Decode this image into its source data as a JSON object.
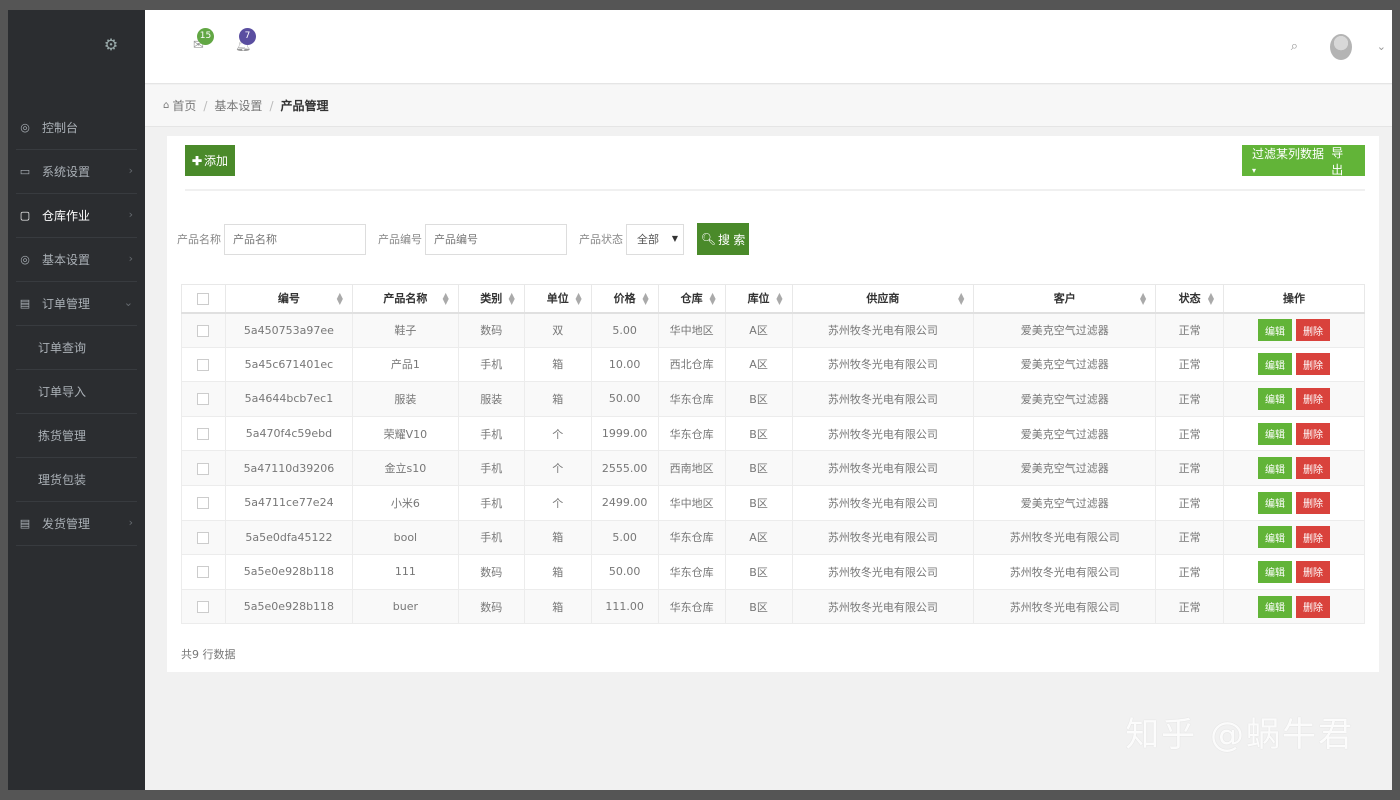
{
  "header": {
    "mail_badge": "15",
    "bell_badge": "7",
    "search_icon": "search-icon",
    "caret": "⌄"
  },
  "sidebar": {
    "items": [
      {
        "label": "控制台",
        "icon": "◎",
        "arrow": ""
      },
      {
        "label": "系统设置",
        "icon": "▭",
        "arrow": "›"
      },
      {
        "label": "仓库作业",
        "icon": "▢",
        "arrow": "›"
      },
      {
        "label": "基本设置",
        "icon": "◎",
        "arrow": "›"
      },
      {
        "label": "订单管理",
        "icon": "▤",
        "arrow": "⌄"
      },
      {
        "label": "订单查询",
        "icon": "",
        "arrow": ""
      },
      {
        "label": "订单导入",
        "icon": "",
        "arrow": ""
      },
      {
        "label": "拣货管理",
        "icon": "",
        "arrow": ""
      },
      {
        "label": "理货包装",
        "icon": "",
        "arrow": ""
      },
      {
        "label": "发货管理",
        "icon": "▤",
        "arrow": "›"
      }
    ]
  },
  "breadcrumb": {
    "home": "首页",
    "level1": "基本设置",
    "current": "产品管理",
    "sep": "/"
  },
  "toolbar": {
    "add_label": "添加",
    "filter_label": "过滤某列数据",
    "export_label": "导出"
  },
  "search": {
    "name_label": "产品名称",
    "name_placeholder": "产品名称",
    "code_label": "产品编号",
    "code_placeholder": "产品编号",
    "status_label": "产品状态",
    "status_value": "全部",
    "search_button": "搜 索"
  },
  "table": {
    "headers": [
      "编号",
      "产品名称",
      "类别",
      "单位",
      "价格",
      "仓库",
      "库位",
      "供应商",
      "客户",
      "状态",
      "操作"
    ],
    "edit_label": "编辑",
    "delete_label": "删除",
    "rows": [
      {
        "id": "5a450753a97ee",
        "name": "鞋子",
        "cat": "数码",
        "unit": "双",
        "price": "5.00",
        "wh": "华中地区",
        "loc": "A区",
        "supplier": "苏州牧冬光电有限公司",
        "customer": "爱美克空气过滤器",
        "status": "正常"
      },
      {
        "id": "5a45c671401ec",
        "name": "产品1",
        "cat": "手机",
        "unit": "箱",
        "price": "10.00",
        "wh": "西北仓库",
        "loc": "A区",
        "supplier": "苏州牧冬光电有限公司",
        "customer": "爱美克空气过滤器",
        "status": "正常"
      },
      {
        "id": "5a4644bcb7ec1",
        "name": "服装",
        "cat": "服装",
        "unit": "箱",
        "price": "50.00",
        "wh": "华东仓库",
        "loc": "B区",
        "supplier": "苏州牧冬光电有限公司",
        "customer": "爱美克空气过滤器",
        "status": "正常"
      },
      {
        "id": "5a470f4c59ebd",
        "name": "荣耀V10",
        "cat": "手机",
        "unit": "个",
        "price": "1999.00",
        "wh": "华东仓库",
        "loc": "B区",
        "supplier": "苏州牧冬光电有限公司",
        "customer": "爱美克空气过滤器",
        "status": "正常"
      },
      {
        "id": "5a47110d39206",
        "name": "金立s10",
        "cat": "手机",
        "unit": "个",
        "price": "2555.00",
        "wh": "西南地区",
        "loc": "B区",
        "supplier": "苏州牧冬光电有限公司",
        "customer": "爱美克空气过滤器",
        "status": "正常"
      },
      {
        "id": "5a4711ce77e24",
        "name": "小米6",
        "cat": "手机",
        "unit": "个",
        "price": "2499.00",
        "wh": "华中地区",
        "loc": "B区",
        "supplier": "苏州牧冬光电有限公司",
        "customer": "爱美克空气过滤器",
        "status": "正常"
      },
      {
        "id": "5a5e0dfa45122",
        "name": "bool",
        "cat": "手机",
        "unit": "箱",
        "price": "5.00",
        "wh": "华东仓库",
        "loc": "A区",
        "supplier": "苏州牧冬光电有限公司",
        "customer": "苏州牧冬光电有限公司",
        "status": "正常"
      },
      {
        "id": "5a5e0e928b118",
        "name": "111",
        "cat": "数码",
        "unit": "箱",
        "price": "50.00",
        "wh": "华东仓库",
        "loc": "B区",
        "supplier": "苏州牧冬光电有限公司",
        "customer": "苏州牧冬光电有限公司",
        "status": "正常"
      },
      {
        "id": "5a5e0e928b118",
        "name": "buer",
        "cat": "数码",
        "unit": "箱",
        "price": "111.00",
        "wh": "华东仓库",
        "loc": "B区",
        "supplier": "苏州牧冬光电有限公司",
        "customer": "苏州牧冬光电有限公司",
        "status": "正常"
      }
    ],
    "total_text": "共9 行数据"
  },
  "watermark": "知乎 @蜗牛君",
  "colors": {
    "sidebar_bg": "#2b2d30",
    "primary_green": "#4a8a2a",
    "light_green": "#62b438",
    "danger_red": "#d9423c"
  }
}
